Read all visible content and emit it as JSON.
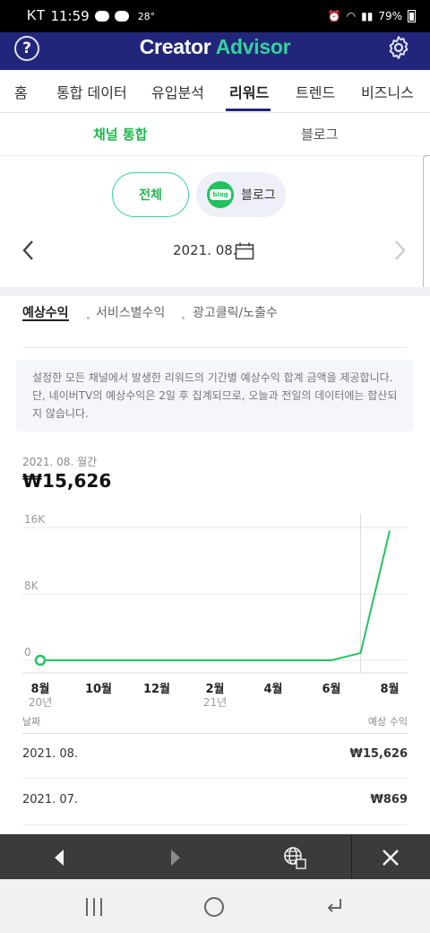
{
  "status_bar": {
    "carrier": "KT",
    "time": "11:59",
    "temperature": "28°",
    "battery": "79%"
  },
  "header": {
    "help_label": "?",
    "brand_first": "Creator",
    "brand_second": "Advisor"
  },
  "main_tabs": [
    "홈",
    "통합 데이터",
    "유입분석",
    "리워드",
    "트렌드",
    "비즈니스"
  ],
  "active_main_tab": "리워드",
  "sub_tabs": {
    "integrated": "채널 통합",
    "blog": "블로그"
  },
  "filters": {
    "all": "전체",
    "blog": "블로그",
    "blog_icon_text": "blog"
  },
  "date_nav": {
    "label": "2021. 08."
  },
  "metric_tabs": {
    "expected": "예상수익",
    "by_service": "서비스별수익",
    "ad_clicks": "광고클릭/노출수"
  },
  "info_text": "설정한 모든 채널에서 발생한 리워드의 기간별 예상수익 합계 금액을 제공합니다. 단, 네이버TV의 예상수익은 2일 후 집계되므로, 오늘과 전일의 데이터에는 합산되지 않습니다.",
  "summary": {
    "period": "2021. 08. 월간",
    "total": "₩15,626"
  },
  "chart_data": {
    "type": "line",
    "x": [
      "2020-08",
      "2020-09",
      "2020-10",
      "2020-11",
      "2020-12",
      "2021-01",
      "2021-02",
      "2021-03",
      "2021-04",
      "2021-05",
      "2021-06",
      "2021-07",
      "2021-08"
    ],
    "series": [
      {
        "values": [
          0,
          0,
          0,
          0,
          0,
          0,
          0,
          0,
          0,
          0,
          0,
          869,
          15626
        ]
      }
    ],
    "x_tick_labels": [
      "8월",
      "10월",
      "12월",
      "2월",
      "4월",
      "6월",
      "8월"
    ],
    "x_year_labels": [
      "20년",
      "21년"
    ],
    "y_tick_labels": [
      "0",
      "8K",
      "16K"
    ],
    "ylim": [
      0,
      16000
    ],
    "grid": true,
    "color": "#22c55e"
  },
  "table": {
    "col_date": "날짜",
    "col_value": "예상 수익",
    "rows": [
      {
        "date": "2021. 08.",
        "value": "₩15,626"
      },
      {
        "date": "2021. 07.",
        "value": "₩869"
      }
    ]
  },
  "colors": {
    "primary": "#22267a",
    "accent": "#1fb84d"
  }
}
